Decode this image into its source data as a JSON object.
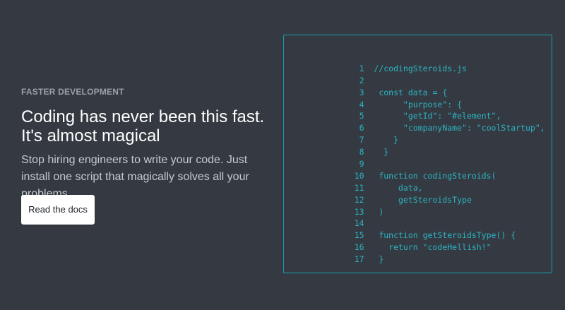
{
  "hero": {
    "eyebrow": "FASTER DEVELOPMENT",
    "headline": "Coding has never been this fast. It's almost magical",
    "subtext": "Stop hiring engineers to write your code. Just install one script that magically solves all your problems.",
    "cta_label": "Read the docs"
  },
  "code": {
    "lines": [
      {
        "number": "1",
        "text": "  //codingSteroids.js"
      },
      {
        "number": "2",
        "text": ""
      },
      {
        "number": "3",
        "text": "   const data = {"
      },
      {
        "number": "4",
        "text": "        \"purpose\": {"
      },
      {
        "number": "5",
        "text": "        \"getId\": \"#element\","
      },
      {
        "number": "6",
        "text": "        \"companyName\": \"coolStartup\","
      },
      {
        "number": "7",
        "text": "      }"
      },
      {
        "number": "8",
        "text": "    }"
      },
      {
        "number": "9",
        "text": ""
      },
      {
        "number": "10",
        "text": "   function codingSteroids("
      },
      {
        "number": "11",
        "text": "       data,"
      },
      {
        "number": "12",
        "text": "       getSteroidsType"
      },
      {
        "number": "13",
        "text": "   )"
      },
      {
        "number": "14",
        "text": ""
      },
      {
        "number": "15",
        "text": "   function getSteroidsType() {"
      },
      {
        "number": "16",
        "text": "     return \"codeHellish!\""
      },
      {
        "number": "17",
        "text": "   }"
      }
    ]
  },
  "colors": {
    "background": "#353a42",
    "accent": "#2bb3c2",
    "panel_border": "#1c9fad",
    "button_bg": "#ffffff"
  }
}
